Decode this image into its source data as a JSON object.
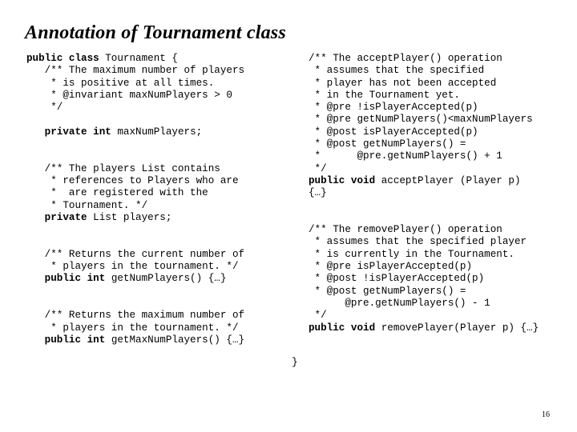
{
  "slide": {
    "title": "Annotation of Tournament class",
    "page_number": "16",
    "closing_brace": "}"
  },
  "left_column": {
    "lines": [
      {
        "bold": "public class ",
        "rest": "Tournament {"
      },
      {
        "bold": "",
        "rest": "   /** The maximum number of players"
      },
      {
        "bold": "",
        "rest": "    * is positive at all times."
      },
      {
        "bold": "",
        "rest": "    * @invariant maxNumPlayers > 0"
      },
      {
        "bold": "",
        "rest": "    */"
      },
      {
        "bold": "",
        "rest": ""
      },
      {
        "bold": "   private int ",
        "rest": "maxNumPlayers;"
      },
      {
        "bold": "",
        "rest": ""
      },
      {
        "bold": "",
        "rest": ""
      },
      {
        "bold": "",
        "rest": "   /** The players List contains"
      },
      {
        "bold": "",
        "rest": "    * references to Players who are"
      },
      {
        "bold": "",
        "rest": "    *  are registered with the"
      },
      {
        "bold": "",
        "rest": "    * Tournament. */"
      },
      {
        "bold": "   private ",
        "rest": "List players;"
      },
      {
        "bold": "",
        "rest": ""
      },
      {
        "bold": "",
        "rest": ""
      },
      {
        "bold": "",
        "rest": "   /** Returns the current number of"
      },
      {
        "bold": "",
        "rest": "    * players in the tournament. */"
      },
      {
        "bold": "   public int ",
        "rest": "getNumPlayers() {…}"
      },
      {
        "bold": "",
        "rest": ""
      },
      {
        "bold": "",
        "rest": ""
      },
      {
        "bold": "",
        "rest": "   /** Returns the maximum number of"
      },
      {
        "bold": "",
        "rest": "    * players in the tournament. */"
      },
      {
        "bold": "   public int ",
        "rest": "getMaxNumPlayers() {…}"
      }
    ]
  },
  "right_column": {
    "lines": [
      {
        "bold": "",
        "rest": "/** The acceptPlayer() operation"
      },
      {
        "bold": "",
        "rest": " * assumes that the specified"
      },
      {
        "bold": "",
        "rest": " * player has not been accepted"
      },
      {
        "bold": "",
        "rest": " * in the Tournament yet."
      },
      {
        "bold": "",
        "rest": " * @pre !isPlayerAccepted(p)"
      },
      {
        "bold": "",
        "rest": " * @pre getNumPlayers()<maxNumPlayers"
      },
      {
        "bold": "",
        "rest": " * @post isPlayerAccepted(p)"
      },
      {
        "bold": "",
        "rest": " * @post getNumPlayers() ="
      },
      {
        "bold": "",
        "rest": " *      @pre.getNumPlayers() + 1"
      },
      {
        "bold": "",
        "rest": " */"
      },
      {
        "bold": "public void ",
        "rest": "acceptPlayer (Player p)"
      },
      {
        "bold": "",
        "rest": "{…}"
      },
      {
        "bold": "",
        "rest": ""
      },
      {
        "bold": "",
        "rest": ""
      },
      {
        "bold": "",
        "rest": "/** The removePlayer() operation"
      },
      {
        "bold": "",
        "rest": " * assumes that the specified player"
      },
      {
        "bold": "",
        "rest": " * is currently in the Tournament."
      },
      {
        "bold": "",
        "rest": " * @pre isPlayerAccepted(p)"
      },
      {
        "bold": "",
        "rest": " * @post !isPlayerAccepted(p)"
      },
      {
        "bold": "",
        "rest": " * @post getNumPlayers() ="
      },
      {
        "bold": "",
        "rest": "      @pre.getNumPlayers() - 1"
      },
      {
        "bold": "",
        "rest": " */"
      },
      {
        "bold": "public void ",
        "rest": "removePlayer(Player p) {…}"
      }
    ]
  }
}
